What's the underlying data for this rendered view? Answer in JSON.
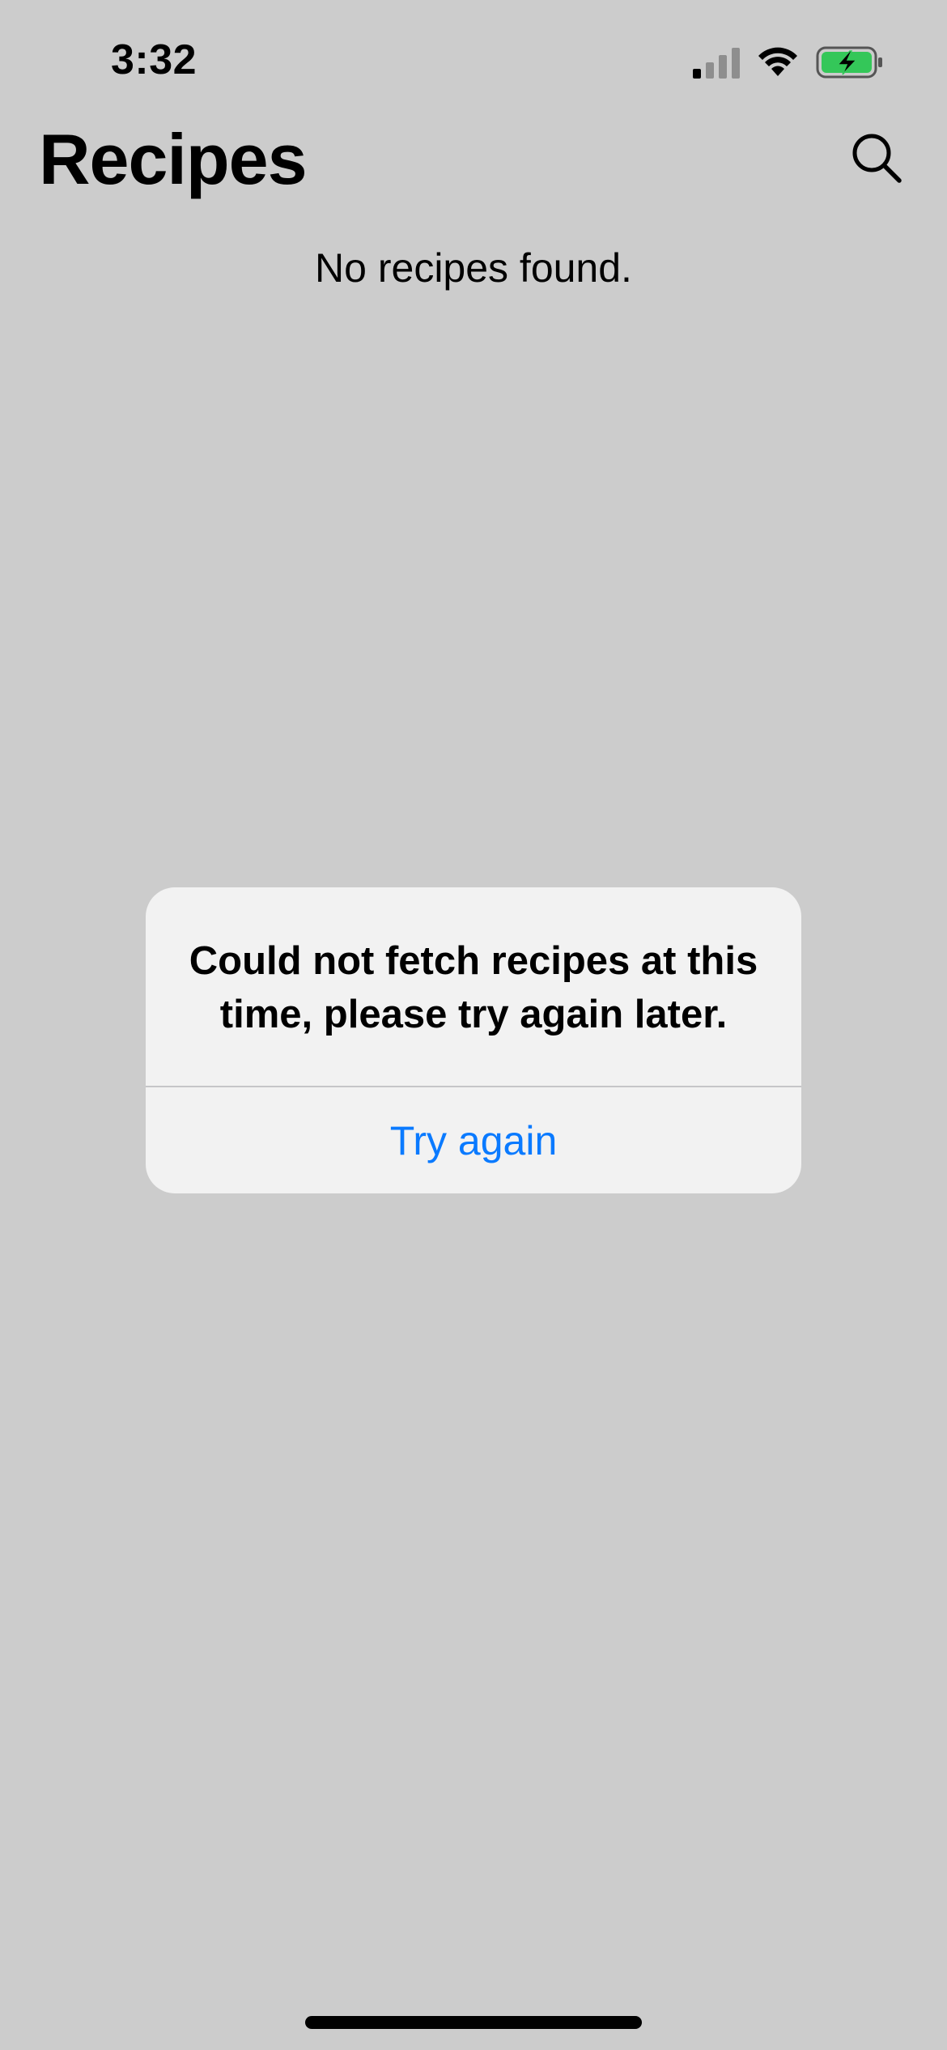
{
  "status_bar": {
    "time": "3:32",
    "icons": [
      "cellular-signal-icon",
      "wifi-icon",
      "battery-charging-icon"
    ],
    "battery_color": "#34c759"
  },
  "nav": {
    "title": "Recipes",
    "search_icon": "search-icon"
  },
  "content": {
    "empty_message": "No recipes found."
  },
  "alert": {
    "message": "Could not fetch recipes at this time, please try again later.",
    "button_label": "Try again",
    "button_color": "#0a7aff"
  }
}
